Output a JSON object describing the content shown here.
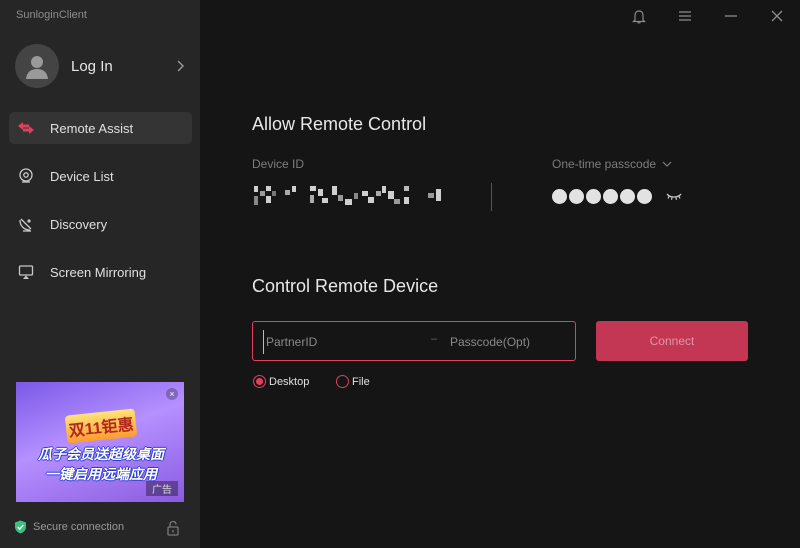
{
  "app": {
    "title": "SunloginClient"
  },
  "sidebar": {
    "login_label": "Log In",
    "items": [
      {
        "label": "Remote Assist",
        "icon": "remote-assist-icon",
        "active": true
      },
      {
        "label": "Device List",
        "icon": "device-list-icon",
        "active": false
      },
      {
        "label": "Discovery",
        "icon": "discovery-icon",
        "active": false
      },
      {
        "label": "Screen Mirroring",
        "icon": "screen-mirroring-icon",
        "active": false
      }
    ],
    "ad": {
      "headline": "双11钜惠",
      "slogan_line1": "瓜子会员送超级桌面",
      "slogan_line2": "一键启用远端应用",
      "tag": "广告"
    },
    "status": "Secure connection"
  },
  "allow": {
    "title": "Allow Remote Control",
    "device_id_label": "Device ID",
    "otp_label": "One-time passcode",
    "passcode_mask_count": 6
  },
  "control": {
    "title": "Control Remote Device",
    "partner_placeholder": "PartnerID",
    "separator": "–",
    "passcode_placeholder": "Passcode(Opt)",
    "connect_label": "Connect",
    "mode_desktop": "Desktop",
    "mode_file": "File",
    "selected_mode": "Desktop"
  },
  "colors": {
    "accent": "#e1405d",
    "sidebar_bg": "#262626",
    "main_bg": "#151515"
  }
}
